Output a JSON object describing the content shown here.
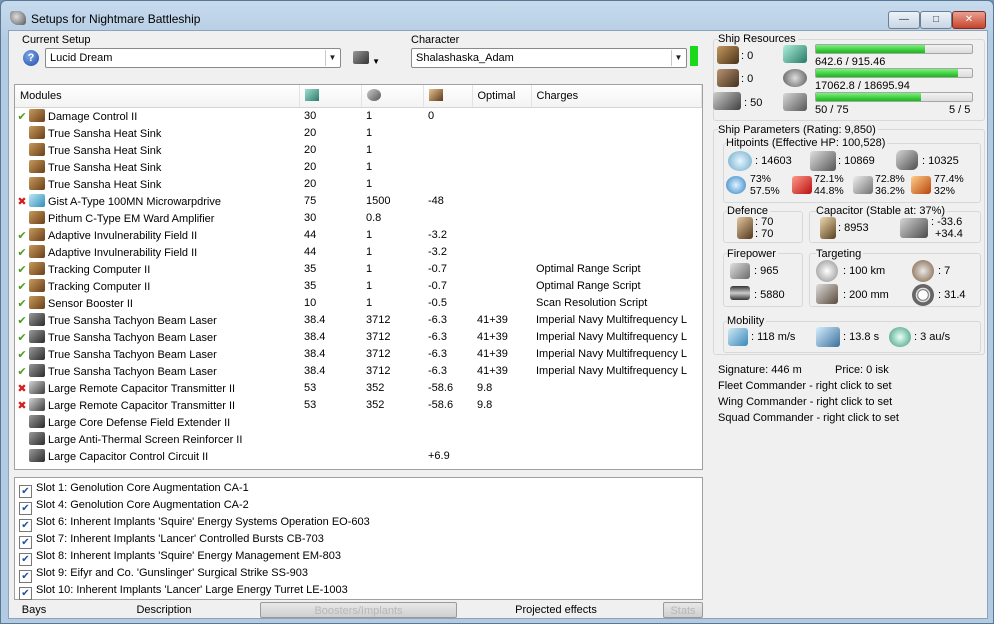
{
  "window": {
    "title": "Setups for Nightmare Battleship"
  },
  "setup": {
    "label": "Current Setup",
    "value": "Lucid Dream"
  },
  "character": {
    "label": "Character",
    "value": "Shalashaska_Adam"
  },
  "modules": {
    "columns": [
      "Modules",
      "",
      "",
      "",
      "Optimal",
      "Charges"
    ],
    "rows": [
      {
        "status": "ok",
        "icon": "damage-control-icon",
        "name": "Damage Control II",
        "cpu": "30",
        "pg": "1",
        "cap": "0",
        "optimal": "",
        "charges": ""
      },
      {
        "status": "",
        "icon": "heat-sink-icon",
        "name": "True Sansha Heat Sink",
        "cpu": "20",
        "pg": "1",
        "cap": "",
        "optimal": "",
        "charges": ""
      },
      {
        "status": "",
        "icon": "heat-sink-icon",
        "name": "True Sansha Heat Sink",
        "cpu": "20",
        "pg": "1",
        "cap": "",
        "optimal": "",
        "charges": ""
      },
      {
        "status": "",
        "icon": "heat-sink-icon",
        "name": "True Sansha Heat Sink",
        "cpu": "20",
        "pg": "1",
        "cap": "",
        "optimal": "",
        "charges": ""
      },
      {
        "status": "",
        "icon": "heat-sink-icon",
        "name": "True Sansha Heat Sink",
        "cpu": "20",
        "pg": "1",
        "cap": "",
        "optimal": "",
        "charges": ""
      },
      {
        "status": "err",
        "icon": "microwarpdrive-icon",
        "name": "Gist A-Type 100MN Microwarpdrive",
        "cpu": "75",
        "pg": "1500",
        "cap": "-48",
        "optimal": "",
        "charges": ""
      },
      {
        "status": "",
        "icon": "ward-amplifier-icon",
        "name": "Pithum C-Type EM Ward Amplifier",
        "cpu": "30",
        "pg": "0.8",
        "cap": "",
        "optimal": "",
        "charges": ""
      },
      {
        "status": "ok",
        "icon": "invulnerability-field-icon",
        "name": "Adaptive Invulnerability Field II",
        "cpu": "44",
        "pg": "1",
        "cap": "-3.2",
        "optimal": "",
        "charges": ""
      },
      {
        "status": "ok",
        "icon": "invulnerability-field-icon",
        "name": "Adaptive Invulnerability Field II",
        "cpu": "44",
        "pg": "1",
        "cap": "-3.2",
        "optimal": "",
        "charges": ""
      },
      {
        "status": "ok",
        "icon": "tracking-computer-icon",
        "name": "Tracking Computer II",
        "cpu": "35",
        "pg": "1",
        "cap": "-0.7",
        "optimal": "",
        "charges": "Optimal Range Script"
      },
      {
        "status": "ok",
        "icon": "tracking-computer-icon",
        "name": "Tracking Computer II",
        "cpu": "35",
        "pg": "1",
        "cap": "-0.7",
        "optimal": "",
        "charges": "Optimal Range Script"
      },
      {
        "status": "ok",
        "icon": "sensor-booster-icon",
        "name": "Sensor Booster II",
        "cpu": "10",
        "pg": "1",
        "cap": "-0.5",
        "optimal": "",
        "charges": "Scan Resolution Script"
      },
      {
        "status": "ok",
        "icon": "beam-laser-icon",
        "name": "True Sansha Tachyon Beam Laser",
        "cpu": "38.4",
        "pg": "3712",
        "cap": "-6.3",
        "optimal": "41+39",
        "charges": "Imperial Navy Multifrequency L"
      },
      {
        "status": "ok",
        "icon": "beam-laser-icon",
        "name": "True Sansha Tachyon Beam Laser",
        "cpu": "38.4",
        "pg": "3712",
        "cap": "-6.3",
        "optimal": "41+39",
        "charges": "Imperial Navy Multifrequency L"
      },
      {
        "status": "ok",
        "icon": "beam-laser-icon",
        "name": "True Sansha Tachyon Beam Laser",
        "cpu": "38.4",
        "pg": "3712",
        "cap": "-6.3",
        "optimal": "41+39",
        "charges": "Imperial Navy Multifrequency L"
      },
      {
        "status": "ok",
        "icon": "beam-laser-icon",
        "name": "True Sansha Tachyon Beam Laser",
        "cpu": "38.4",
        "pg": "3712",
        "cap": "-6.3",
        "optimal": "41+39",
        "charges": "Imperial Navy Multifrequency L"
      },
      {
        "status": "err",
        "icon": "remote-capacitor-icon",
        "name": "Large Remote Capacitor Transmitter II",
        "cpu": "53",
        "pg": "352",
        "cap": "-58.6",
        "optimal": "9.8",
        "charges": ""
      },
      {
        "status": "err",
        "icon": "remote-capacitor-icon",
        "name": "Large Remote Capacitor Transmitter II",
        "cpu": "53",
        "pg": "352",
        "cap": "-58.6",
        "optimal": "9.8",
        "charges": ""
      },
      {
        "status": "",
        "icon": "rig-icon",
        "name": "Large Core Defense Field Extender II",
        "cpu": "",
        "pg": "",
        "cap": "",
        "optimal": "",
        "charges": ""
      },
      {
        "status": "",
        "icon": "rig-icon",
        "name": "Large Anti-Thermal Screen Reinforcer II",
        "cpu": "",
        "pg": "",
        "cap": "",
        "optimal": "",
        "charges": ""
      },
      {
        "status": "",
        "icon": "rig-icon",
        "name": "Large Capacitor Control Circuit II",
        "cpu": "",
        "pg": "",
        "cap": "+6.9",
        "optimal": "",
        "charges": ""
      }
    ]
  },
  "implants": [
    "Slot 1: Genolution Core Augmentation CA-1",
    "Slot 4: Genolution Core Augmentation CA-2",
    "Slot 6: Inherent Implants 'Squire' Energy Systems Operation EO-603",
    "Slot 7: Inherent Implants 'Lancer' Controlled Bursts CB-703",
    "Slot 8: Inherent Implants 'Squire' Energy Management EM-803",
    "Slot 9: Eifyr and Co. 'Gunslinger' Surgical Strike SS-903",
    "Slot 10: Inherent Implants 'Lancer' Large Energy Turret LE-1003"
  ],
  "tabs": [
    "Bays",
    "Description",
    "Boosters/Implants",
    "Projected effects",
    "Stats"
  ],
  "resources": {
    "title": "Ship Resources",
    "turret_slots": ": 0",
    "launcher_slots": ": 0",
    "drone_count": ": 50",
    "cpu_text": "642.6 / 915.46",
    "cpu_fill": 0.7,
    "power_text": "17062.8 / 18695.94",
    "power_fill": 0.91,
    "drones_text": "50 / 75",
    "drones_active": "5 / 5",
    "drones_fill": 0.67
  },
  "params": {
    "title": "Ship Parameters (Rating: 9,850)",
    "hitpoints_title": "Hitpoints (Effective HP: 100,528)",
    "shield_hp": ": 14603",
    "armor_hp": ": 10869",
    "hull_hp": ": 10325",
    "res_em": [
      "73%",
      "57.5%"
    ],
    "res_therm": [
      "72.1%",
      "44.8%"
    ],
    "res_kin": [
      "72.8%",
      "36.2%"
    ],
    "res_exp": [
      "77.4%",
      "32%"
    ],
    "defence_title": "Defence",
    "defence_a": ": 70",
    "defence_b": ": 70",
    "capacitor_title": "Capacitor (Stable at: 37%)",
    "cap_amount": ": 8953",
    "cap_use": ": -33.6",
    "cap_regen": "+34.4",
    "firepower_title": "Firepower",
    "fire_a": ": 965",
    "fire_b": ": 5880",
    "targeting_title": "Targeting",
    "target_range": ": 100 km",
    "max_targets": ": 7",
    "sig_radius": ": 200 mm",
    "scan_res": ": 31.4",
    "mobility_title": "Mobility",
    "velocity": ": 118 m/s",
    "align": ": 13.8 s",
    "warp": ": 3 au/s",
    "signature": "Signature: 446 m",
    "price": "Price: 0 isk",
    "fleet": "Fleet Commander - right click to set",
    "wing": "Wing Commander - right click to set",
    "squad": "Squad Commander - right click to set"
  }
}
